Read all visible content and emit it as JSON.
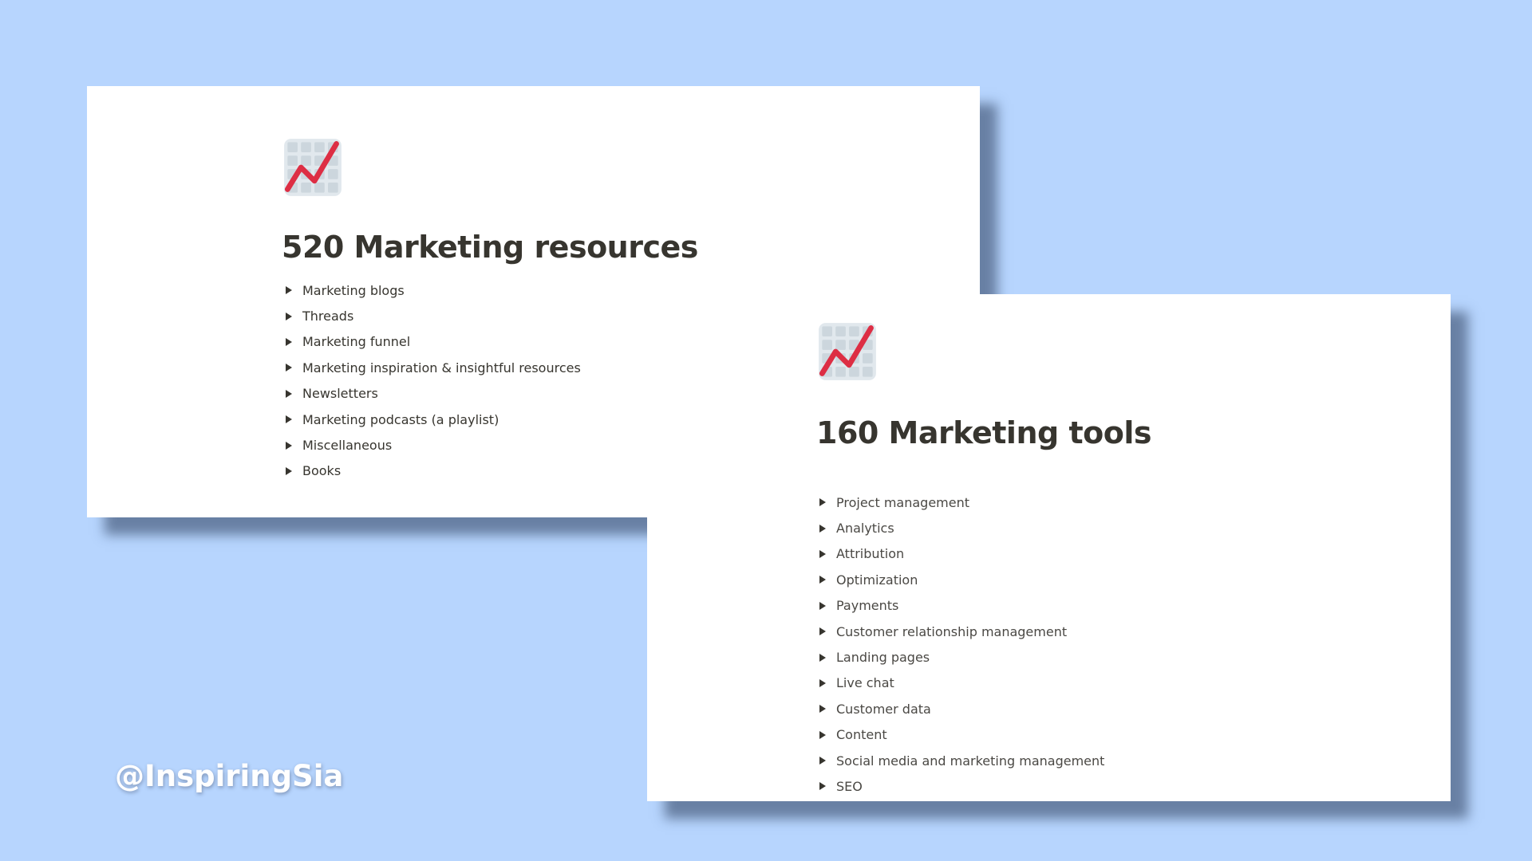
{
  "background_color": "#b7d5fe",
  "resources_page": {
    "icon": "chart-increasing-icon",
    "title": "520 Marketing resources",
    "items": [
      {
        "label": "Marketing blogs"
      },
      {
        "label": "Threads"
      },
      {
        "label": "Marketing funnel"
      },
      {
        "label": "Marketing inspiration & insightful resources"
      },
      {
        "label": "Newsletters"
      },
      {
        "label": "Marketing podcasts (a playlist)"
      },
      {
        "label": "Miscellaneous"
      },
      {
        "label": "Books"
      }
    ]
  },
  "tools_page": {
    "icon": "chart-increasing-icon",
    "title": "160 Marketing tools",
    "items": [
      {
        "label": "Project management"
      },
      {
        "label": "Analytics"
      },
      {
        "label": "Attribution"
      },
      {
        "label": "Optimization"
      },
      {
        "label": "Payments"
      },
      {
        "label": "Customer relationship management"
      },
      {
        "label": "Landing pages"
      },
      {
        "label": "Live chat"
      },
      {
        "label": "Customer data"
      },
      {
        "label": "Content"
      },
      {
        "label": "Social media and marketing management"
      },
      {
        "label": "SEO"
      }
    ]
  },
  "watermark": "@InspiringSia",
  "colors": {
    "icon_line": "#dd2e44",
    "icon_grid": "#ccd6dd",
    "icon_frame": "#e1e8ed",
    "text": "#37352f"
  }
}
